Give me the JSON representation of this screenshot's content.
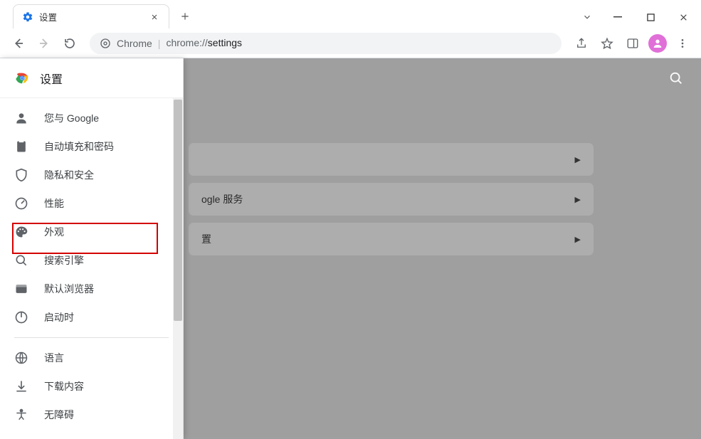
{
  "window": {
    "tabs": [
      {
        "title": "设置"
      }
    ]
  },
  "toolbar": {
    "site_label": "Chrome",
    "url_host": "chrome://",
    "url_path": "settings"
  },
  "page": {
    "title": "设置",
    "cards": [
      {
        "label": ""
      },
      {
        "label": "ogle 服务"
      },
      {
        "label": "置"
      }
    ]
  },
  "sidebar": {
    "title": "设置",
    "group1": [
      {
        "icon": "person-icon",
        "label": "您与 Google"
      },
      {
        "icon": "clipboard-icon",
        "label": "自动填充和密码"
      },
      {
        "icon": "shield-icon",
        "label": "隐私和安全"
      },
      {
        "icon": "gauge-icon",
        "label": "性能"
      },
      {
        "icon": "palette-icon",
        "label": "外观"
      },
      {
        "icon": "search-icon",
        "label": "搜索引擎"
      },
      {
        "icon": "browser-icon",
        "label": "默认浏览器"
      },
      {
        "icon": "power-icon",
        "label": "启动时"
      }
    ],
    "group2": [
      {
        "icon": "globe-icon",
        "label": "语言"
      },
      {
        "icon": "download-icon",
        "label": "下载内容"
      },
      {
        "icon": "accessibility-icon",
        "label": "无障碍"
      }
    ]
  }
}
